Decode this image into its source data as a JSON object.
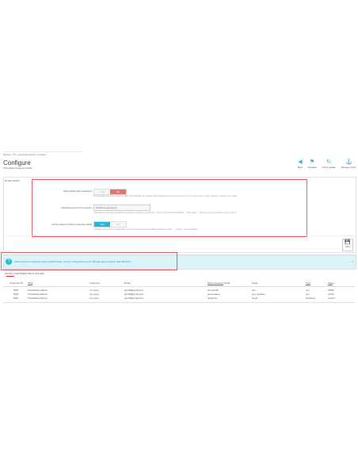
{
  "breadcrumb": [
    "Modules",
    "TPC_extracustomerfields",
    "Configure"
  ],
  "page": {
    "title": "Configure",
    "subtitle": "TPC Extra Customer Fields"
  },
  "toolbar": [
    {
      "label": "Back",
      "icon": "back-icon"
    },
    {
      "label": "Translate",
      "icon": "flag-icon"
    },
    {
      "label": "Check update",
      "icon": "refresh-icon"
    },
    {
      "label": "Manage hooks",
      "icon": "anchor-icon"
    }
  ],
  "settings": {
    "header": "SETTINGS",
    "fields": [
      {
        "label": "Move fields after password",
        "yes": "YES",
        "no": "NO",
        "selected": "NO",
        "help": "On registration and guest checkout, place TPC fields after the password field (instead of at the end of the form). If your theme uses another checkout, customer, etc. review."
      },
      {
        "label": "Checkout guest form selector",
        "value": "#checkout-guest-form",
        "help": "CSS selector of the guest registration container for checkout. Usually first... for it to work. Default: #checkout... If the section ... Change it if your theme does not use this id."
      },
      {
        "label": "Extra customer fields in account detail",
        "yes": "YES",
        "no": "NO",
        "selected": "YES",
        "help": "If enabled, extra customer fields will be shown too when the account detail registration / order / ... entered ... account/detail in ..."
      }
    ],
    "save_label": "Save"
  },
  "alert": {
    "text": "Values saved for customers (only enabled fields). You can configure them here: Manage extra customer field definitions",
    "link": "Manage extra customer field definitions"
  },
  "table": {
    "title": "EXTRA CUSTOMER FIELD VALUES",
    "columns": [
      "Customer ID",
      "Shop",
      "Customer",
      "Email",
      "Extra Customer Field",
      "Code",
      "Type",
      "Value"
    ],
    "rows": [
      [
        "5902",
        "PrestaShop Addons",
        "tom gong",
        "tgon99@gmail.com",
        "text test 88",
        "test",
        "text",
        "78185"
      ],
      [
        "5902",
        "PrestaShop Addons",
        "tom gong",
        "tgon99@gmail.com",
        "test textarea",
        "test_textarea",
        "text",
        "22222"
      ],
      [
        "5902",
        "PrestaShop Addons",
        "tom gong",
        "tgon99@gmail.com",
        "dropdown",
        "dropd",
        "dropdown",
        "select1"
      ]
    ]
  }
}
